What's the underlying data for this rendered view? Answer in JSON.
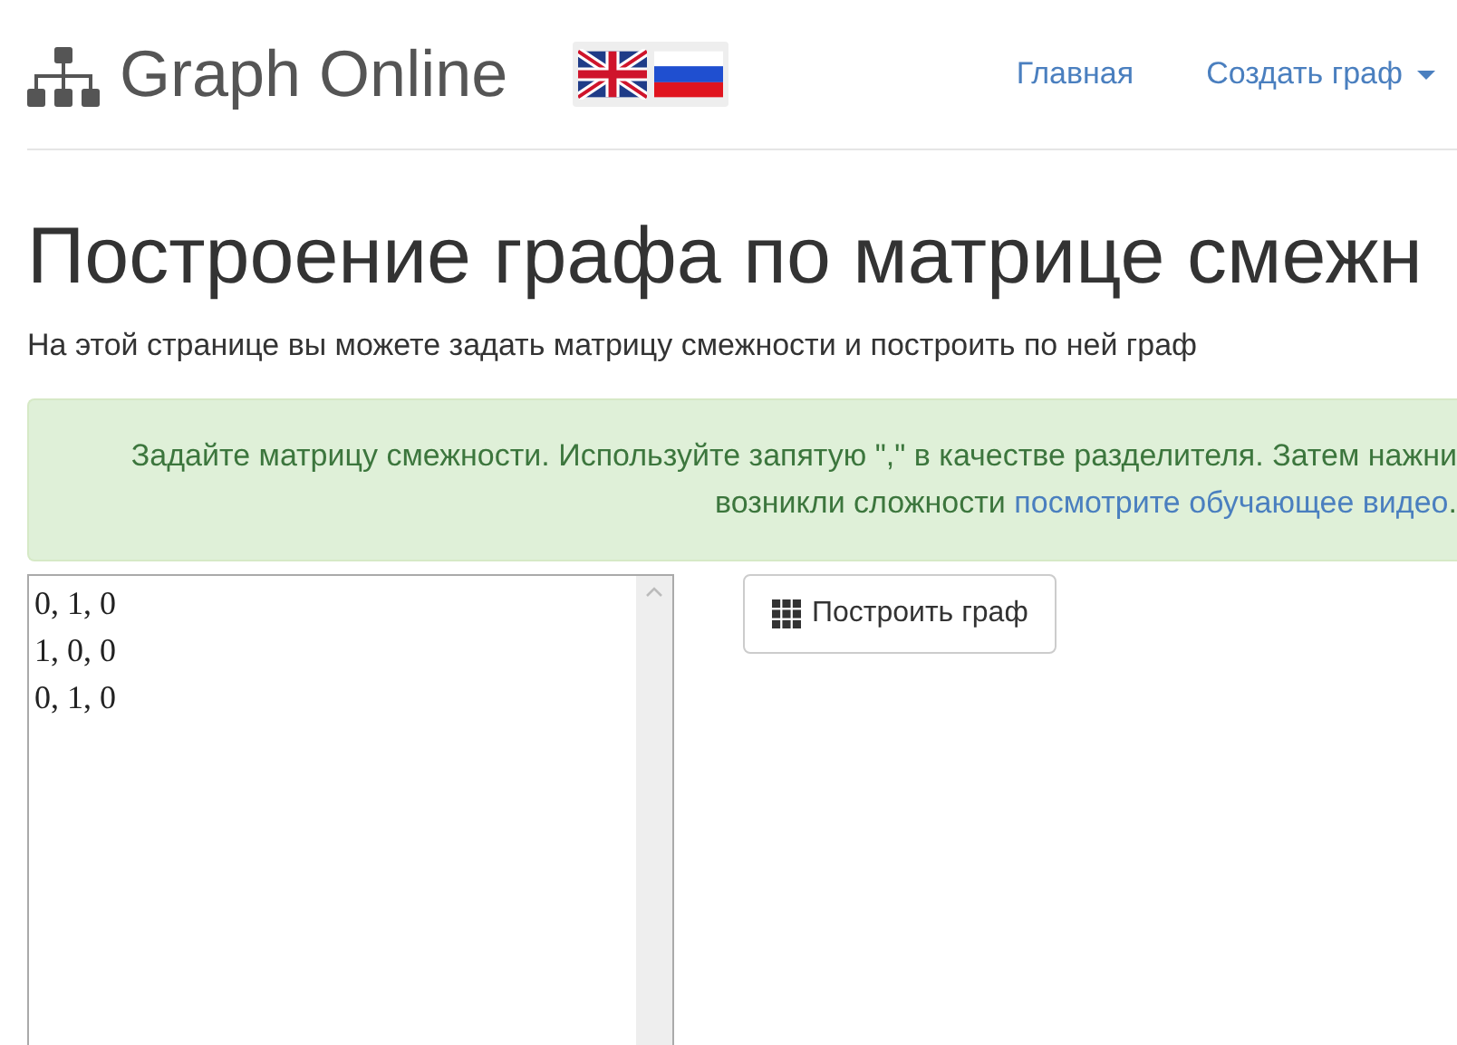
{
  "header": {
    "brand": "Graph Online",
    "languages": [
      {
        "kind": "uk"
      },
      {
        "kind": "russia"
      }
    ],
    "nav": [
      {
        "label": "Главная",
        "dropdown": false
      },
      {
        "label": "Создать граф",
        "dropdown": true
      }
    ]
  },
  "title": "Построение графа по матрице смежн",
  "subtitle": "На этой странице вы можете задать матрицу смежности и построить по ней граф",
  "alert": {
    "line1": "Задайте матрицу смежности. Используйте запятую \",\" в качестве разделителя. Затем нажни",
    "line2": "возникли сложности",
    "link": "посмотрите обучающее видео",
    "end": "."
  },
  "matrix": {
    "lines": [
      "0, 1, 0",
      "1, 0, 0",
      "0, 1, 0"
    ]
  },
  "build_button": "Построить граф"
}
